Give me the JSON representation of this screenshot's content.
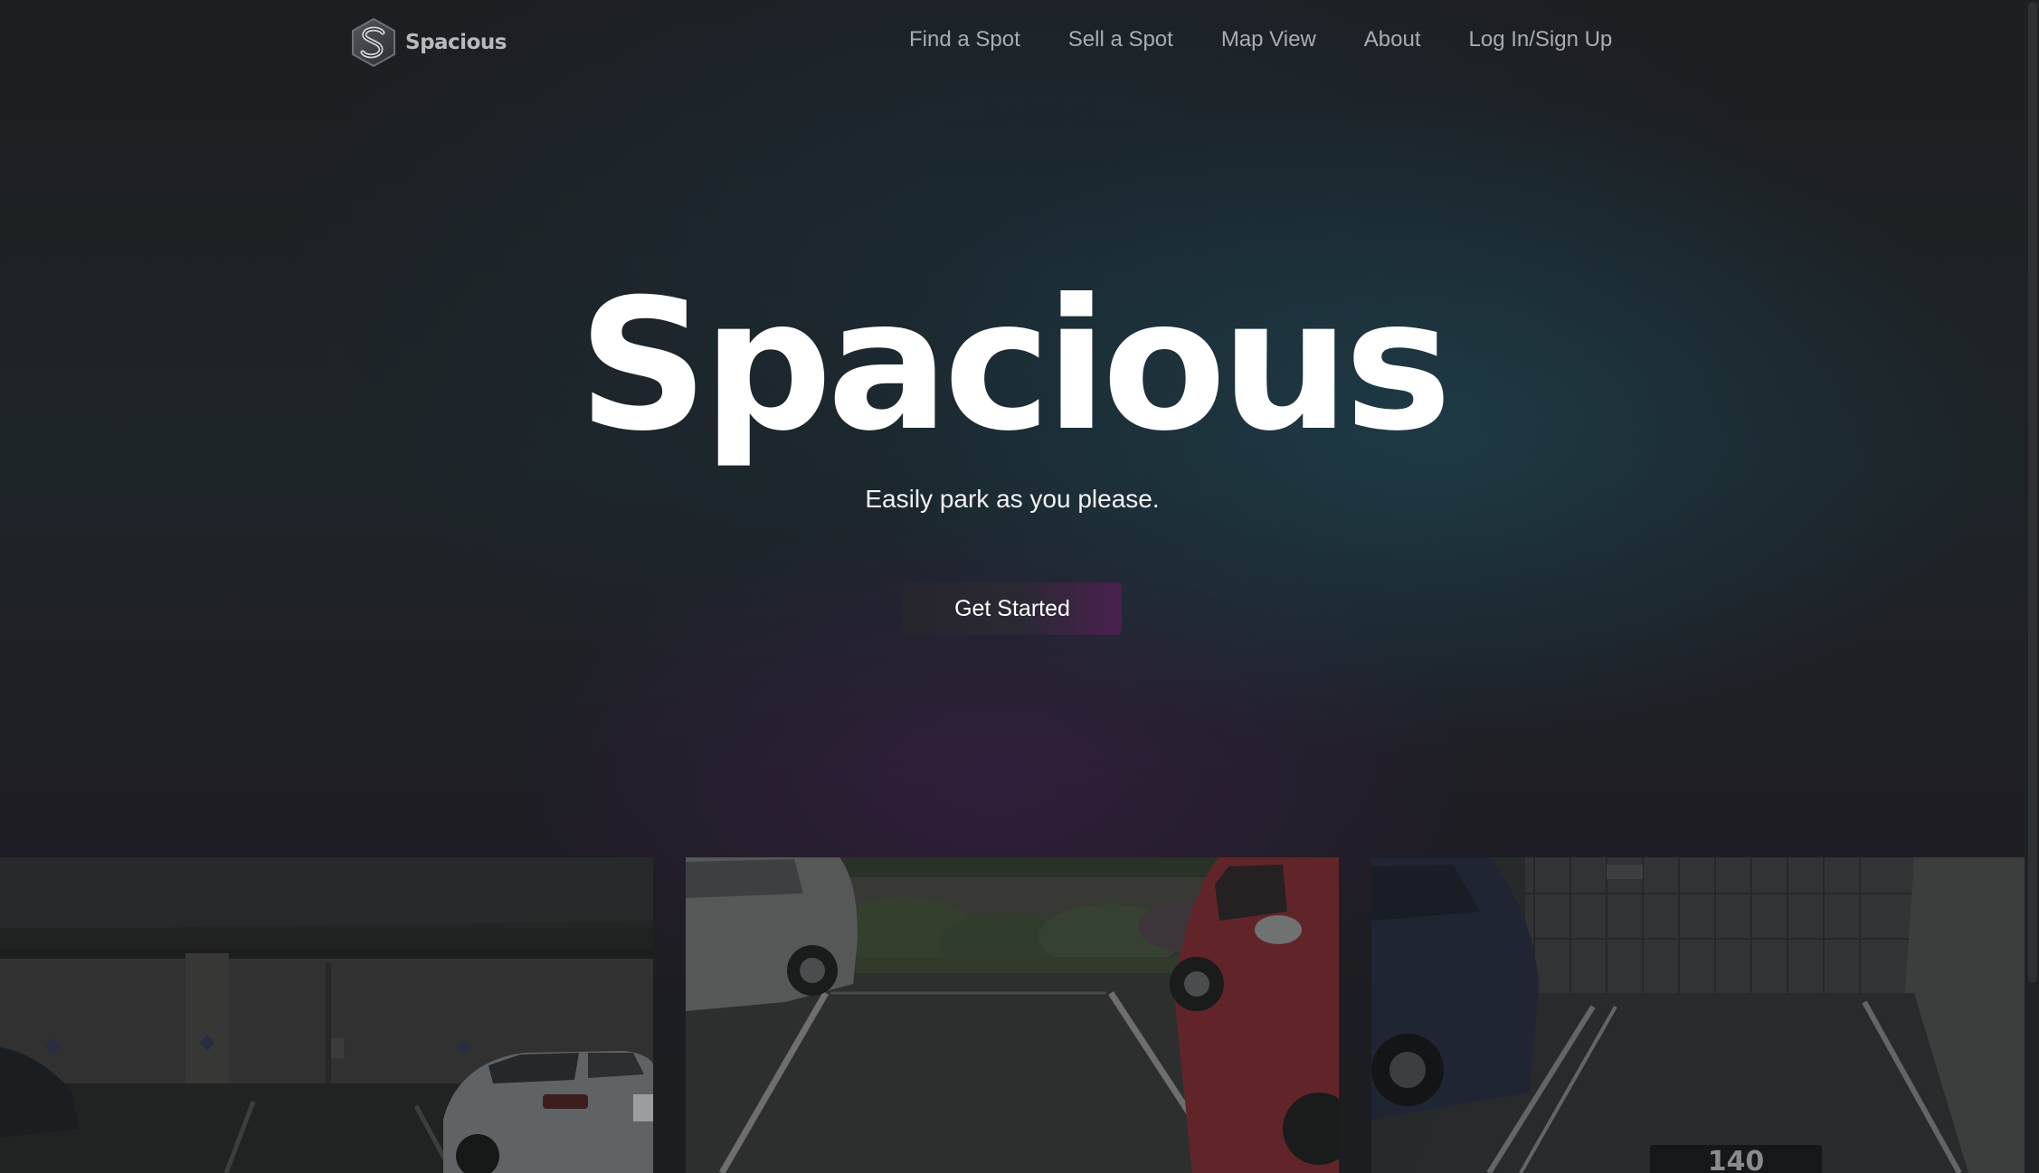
{
  "nav": {
    "brand_name": "Spacious",
    "links": [
      {
        "label": "Find a Spot"
      },
      {
        "label": "Sell a Spot"
      },
      {
        "label": "Map View"
      },
      {
        "label": "About"
      },
      {
        "label": "Log In/Sign Up"
      }
    ]
  },
  "hero": {
    "title": "Spacious",
    "subtitle": "Easily park as you please.",
    "cta_label": "Get Started"
  },
  "gallery": {
    "photos": [
      {
        "subject": "underground parking garage with white car"
      },
      {
        "subject": "outdoor parking space between silver SUV and red car"
      },
      {
        "subject": "garage parking space numbered",
        "stall_number": "140"
      }
    ]
  },
  "colors": {
    "background": "#1b1d20",
    "accent_teal": "#1e4a5a",
    "accent_purple": "#4a2050",
    "text": "#ffffff",
    "nav_text": "#a9adb1"
  }
}
